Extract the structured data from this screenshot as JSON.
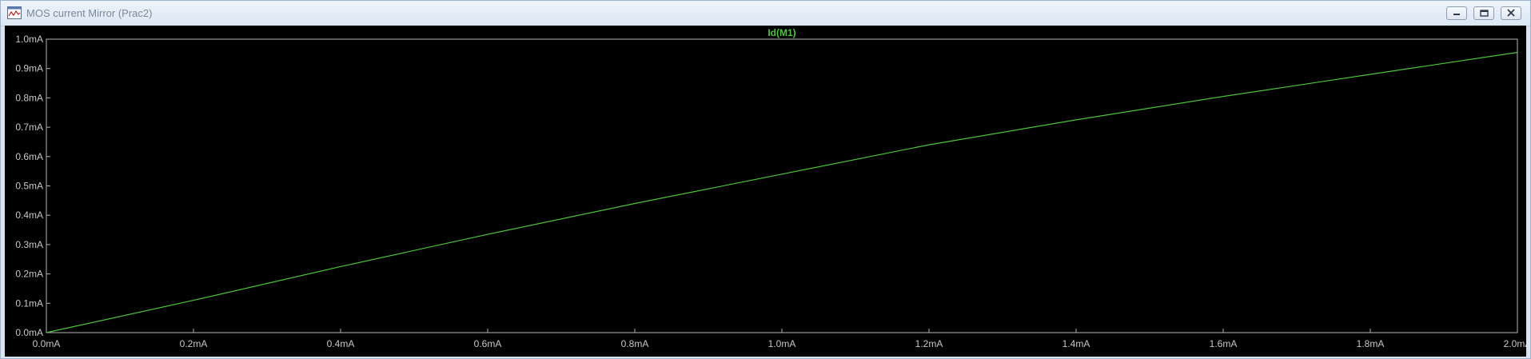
{
  "window": {
    "title": "MOS current Mirror (Prac2)",
    "icon": "waveform-window-icon"
  },
  "controls": {
    "minimize_icon": "minimize-icon",
    "maximize_icon": "restore-icon",
    "close_icon": "close-icon"
  },
  "colors": {
    "background": "#000000",
    "axis": "#b4b4b4",
    "tick_label": "#c8c8c8",
    "trace": "#4ec43c"
  },
  "chart_data": {
    "type": "line",
    "title": "",
    "xlabel": "",
    "ylabel": "",
    "xlim": [
      0,
      2.0
    ],
    "ylim": [
      0,
      1.0
    ],
    "grid": false,
    "x_ticks": [
      "0.0mA",
      "0.2mA",
      "0.4mA",
      "0.6mA",
      "0.8mA",
      "1.0mA",
      "1.2mA",
      "1.4mA",
      "1.6mA",
      "1.8mA",
      "2.0mA"
    ],
    "y_ticks": [
      "0.0mA",
      "0.1mA",
      "0.2mA",
      "0.3mA",
      "0.4mA",
      "0.5mA",
      "0.6mA",
      "0.7mA",
      "0.8mA",
      "0.9mA",
      "1.0mA"
    ],
    "series": [
      {
        "name": "Id(M1)",
        "x": [
          0.0,
          0.2,
          0.4,
          0.6,
          0.8,
          1.0,
          1.2,
          1.4,
          1.6,
          1.8,
          2.0
        ],
        "y": [
          0.0,
          0.11,
          0.225,
          0.335,
          0.44,
          0.54,
          0.64,
          0.725,
          0.805,
          0.88,
          0.955
        ]
      }
    ]
  }
}
